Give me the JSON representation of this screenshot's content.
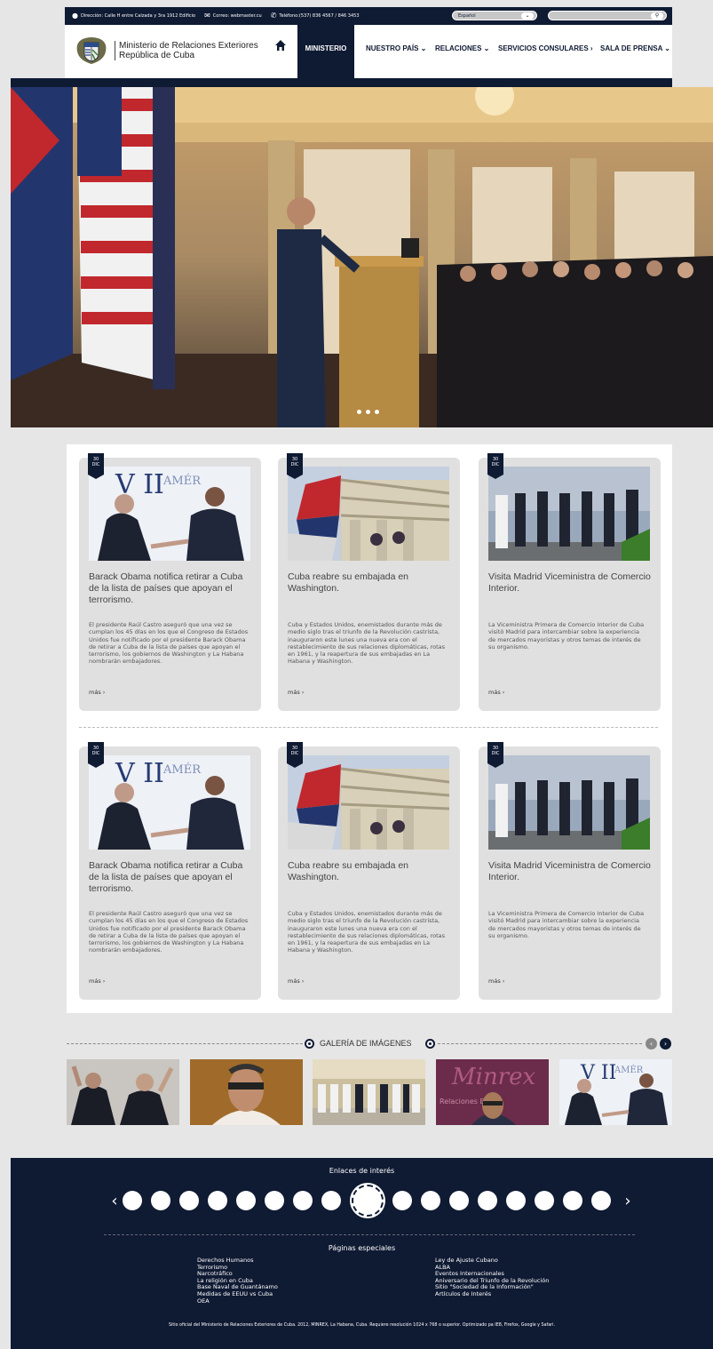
{
  "topbar": {
    "address": "Dirección: Calle H entre Calzada y 3ra 1912 Edificio",
    "email": "Correo: webmaster.cu",
    "phone": "Teléfono:(537) 836 4567 / 846 3453",
    "language": "Español"
  },
  "header": {
    "org_line1": "Ministerio de Relaciones Exteriores",
    "org_line2": "República de Cuba",
    "nav": {
      "active": "MINISTERIO",
      "items": [
        "NUESTRO PAÍS ⌄",
        "RELACIONES ⌄",
        "SERVICIOS CONSULARES ›",
        "SALA DE PRENSA ⌄"
      ]
    }
  },
  "news": {
    "cards": [
      {
        "day": "30",
        "month": "DIC",
        "title": "Barack Obama notifica retirar a Cuba de la lista de países que apoyan el terrorismo.",
        "excerpt": "El presidente Raúl Castro aseguró que una vez se cumplan los 45 días en los que el Congreso de Estados Unidos fue notificado por el presidente Barack Obama de retirar a Cuba de la lista de países que apoyan el terrorismo, los gobiernos de Washington y La Habana nombrarán embajadores.",
        "more": "más ›"
      },
      {
        "day": "30",
        "month": "DIC",
        "title": "Cuba reabre su embajada en Washington.",
        "excerpt": "Cuba y Estados Unidos, enemistados durante más de medio siglo tras el triunfo de la Revolución castrista, inauguraron este lunes una nueva era con el restablecimiento de sus relaciones diplomáticas, rotas en 1961, y la reapertura de sus embajadas en La Habana y Washington.",
        "more": "más ›"
      },
      {
        "day": "30",
        "month": "DIC",
        "title": "Visita Madrid Viceministra de Comercio Interior.",
        "excerpt": "La Viceministra Primera de Comercio Interior de Cuba visitó Madrid para intercambiar sobre la experiencia de mercados mayoristas y otros temas de interés de su organismo.",
        "more": "más ›"
      }
    ]
  },
  "gallery": {
    "title": "GALERÍA DE IMÁGENES",
    "prev": "‹",
    "next": "›"
  },
  "footer": {
    "links_title": "Enlaces de interés",
    "prev": "‹",
    "next": "›",
    "special_title": "Páginas especiales",
    "col1": [
      "Derechos Humanos",
      "Terrorismo",
      "Narcotráfico",
      "La religión en Cuba",
      "Base Naval de Guantánamo",
      "Medidas de EEUU vs Cuba",
      "OEA"
    ],
    "col2": [
      "Ley de Ajuste Cubano",
      "ALBA",
      "Eventos Internacionales",
      "Aniversario del Triunfo de la Revolución",
      "Sitio \"Sociedad de la Información\"",
      "Artículos de Interés"
    ],
    "legal": "Sitio oficial del Ministerio de Relaciones Exteriores de Cuba. 2012, MINREX, La Habana, Cuba. Requiere resolución 1024 x 768 o superior. Optimizado pa IE8, Firefox, Google y Safari."
  },
  "colors": {
    "navy": "#0f1a33",
    "panel": "#e0e0e0",
    "background": "#e6e6e6"
  }
}
